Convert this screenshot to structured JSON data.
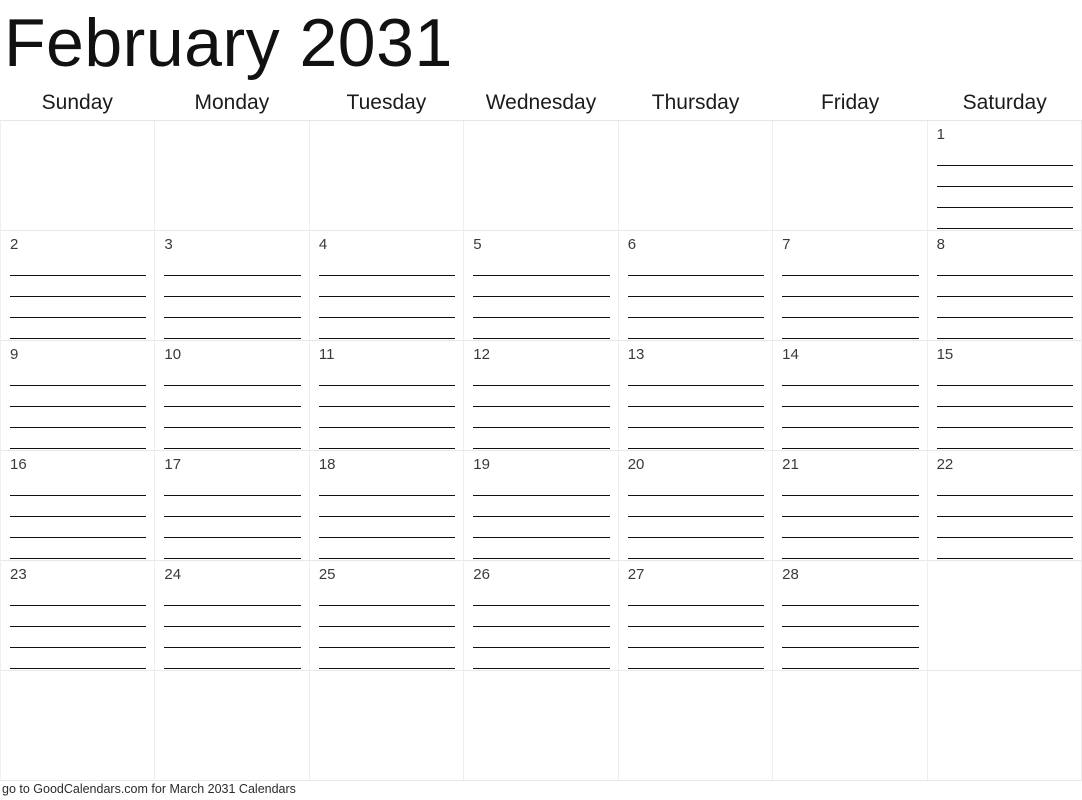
{
  "header": {
    "month_title": "February 2031",
    "month": "February",
    "year": "2031"
  },
  "weekdays": [
    {
      "label": "Sunday"
    },
    {
      "label": "Monday"
    },
    {
      "label": "Tuesday"
    },
    {
      "label": "Wednesday"
    },
    {
      "label": "Thursday"
    },
    {
      "label": "Friday"
    },
    {
      "label": "Saturday"
    }
  ],
  "calendar": {
    "lines_per_day": 4,
    "rows": [
      [
        {
          "day": "",
          "blank": true
        },
        {
          "day": "",
          "blank": true
        },
        {
          "day": "",
          "blank": true
        },
        {
          "day": "",
          "blank": true
        },
        {
          "day": "",
          "blank": true
        },
        {
          "day": "",
          "blank": true
        },
        {
          "day": "1",
          "blank": false
        }
      ],
      [
        {
          "day": "2",
          "blank": false
        },
        {
          "day": "3",
          "blank": false
        },
        {
          "day": "4",
          "blank": false
        },
        {
          "day": "5",
          "blank": false
        },
        {
          "day": "6",
          "blank": false
        },
        {
          "day": "7",
          "blank": false
        },
        {
          "day": "8",
          "blank": false
        }
      ],
      [
        {
          "day": "9",
          "blank": false
        },
        {
          "day": "10",
          "blank": false
        },
        {
          "day": "11",
          "blank": false
        },
        {
          "day": "12",
          "blank": false
        },
        {
          "day": "13",
          "blank": false
        },
        {
          "day": "14",
          "blank": false
        },
        {
          "day": "15",
          "blank": false
        }
      ],
      [
        {
          "day": "16",
          "blank": false
        },
        {
          "day": "17",
          "blank": false
        },
        {
          "day": "18",
          "blank": false
        },
        {
          "day": "19",
          "blank": false
        },
        {
          "day": "20",
          "blank": false
        },
        {
          "day": "21",
          "blank": false
        },
        {
          "day": "22",
          "blank": false
        }
      ],
      [
        {
          "day": "23",
          "blank": false
        },
        {
          "day": "24",
          "blank": false
        },
        {
          "day": "25",
          "blank": false
        },
        {
          "day": "26",
          "blank": false
        },
        {
          "day": "27",
          "blank": false
        },
        {
          "day": "28",
          "blank": false
        },
        {
          "day": "",
          "blank": true
        }
      ],
      [
        {
          "day": "",
          "blank": true
        },
        {
          "day": "",
          "blank": true
        },
        {
          "day": "",
          "blank": true
        },
        {
          "day": "",
          "blank": true
        },
        {
          "day": "",
          "blank": true
        },
        {
          "day": "",
          "blank": true
        },
        {
          "day": "",
          "blank": true
        }
      ]
    ]
  },
  "footer": {
    "text": "go to GoodCalendars.com for March 2031 Calendars"
  },
  "colors": {
    "title_text": "#111111",
    "weekday_text": "#1b1b1b",
    "day_number_text": "#3a3a3a",
    "rule_line": "#111111",
    "grid_border": "#eeeeee",
    "footer_text": "#2c2c2c",
    "background": "#ffffff"
  }
}
